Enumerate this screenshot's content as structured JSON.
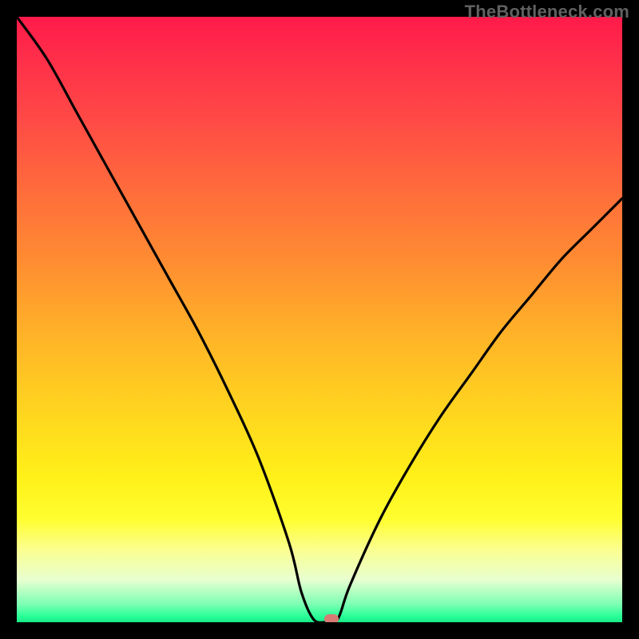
{
  "watermark": "TheBottleneck.com",
  "chart_data": {
    "type": "line",
    "title": "",
    "xlabel": "",
    "ylabel": "",
    "xlim": [
      0,
      100
    ],
    "ylim": [
      0,
      100
    ],
    "x": [
      0,
      5,
      10,
      15,
      20,
      25,
      30,
      35,
      40,
      45,
      47,
      49,
      51,
      53,
      55,
      60,
      65,
      70,
      75,
      80,
      85,
      90,
      95,
      100
    ],
    "values": [
      100,
      93,
      84,
      75,
      66,
      57,
      48,
      38,
      27,
      13,
      5,
      0.5,
      0,
      0.5,
      6,
      17,
      26,
      34,
      41,
      48,
      54,
      60,
      65,
      70
    ],
    "optimum_x": 51,
    "marker": {
      "x": 52,
      "y": 0.5
    },
    "legend": false,
    "grid": false,
    "background": "rainbow-vertical-gradient"
  },
  "colors": {
    "curve": "#000000",
    "frame": "#000000",
    "marker": "#d77b74",
    "watermark": "#606060"
  }
}
